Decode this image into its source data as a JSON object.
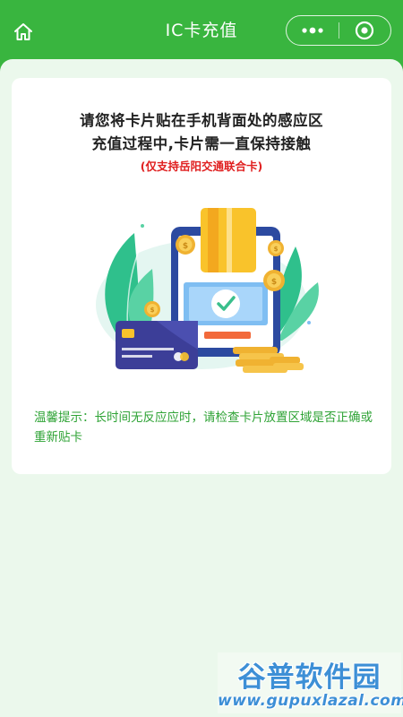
{
  "header": {
    "title": "IC卡充值",
    "home_icon": "home-icon",
    "more_icon": "more-dots-icon",
    "close_icon": "close-target-icon"
  },
  "card": {
    "line1": "请您将卡片贴在手机背面处的感应区",
    "line2": "充值过程中,卡片需一直保持接触",
    "note": "(仅支持岳阳交通联合卡)",
    "illustration_icon": "nfc-card-payment-illustration",
    "tip": "温馨提示：长时间无反应应时，请检查卡片放置区域是否正确或重新贴卡"
  },
  "watermark": {
    "brand": "谷普软件园",
    "url": "www.gupuxlazal.com"
  },
  "colors": {
    "brand_green": "#39b53f",
    "background": "#ebf8ec",
    "note_red": "#e02020",
    "tip_green": "#2fa336"
  }
}
